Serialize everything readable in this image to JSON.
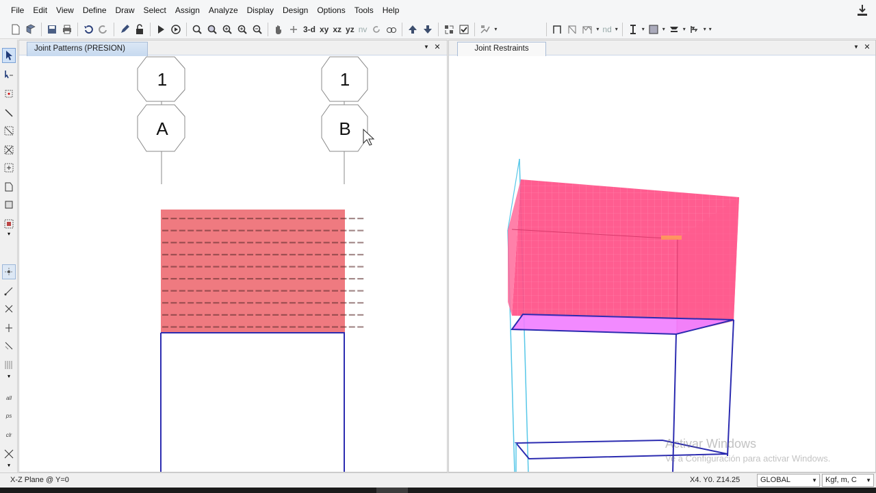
{
  "menu": [
    "File",
    "Edit",
    "View",
    "Define",
    "Draw",
    "Select",
    "Assign",
    "Analyze",
    "Display",
    "Design",
    "Options",
    "Tools",
    "Help"
  ],
  "toolbar": {
    "view_3d": "3-d",
    "view_xy": "xy",
    "view_xz": "xz",
    "view_yz": "yz",
    "view_nv": "nv",
    "nd_label": "nd"
  },
  "left_panel": {
    "tab_title": "Joint Patterns (PRESION)",
    "grid_bubbles": [
      {
        "row_label": "1",
        "col_label": "A"
      },
      {
        "row_label": "1",
        "col_label": "B"
      }
    ]
  },
  "right_panel": {
    "tab_title": "Joint Restraints"
  },
  "watermark": {
    "title": "Activar Windows",
    "subtitle": "Ve a Configuración para activar Windows."
  },
  "statusbar": {
    "plane": "X-Z Plane @ Y=0",
    "coords": "X4.  Y0.  Z14.25",
    "coord_system": "GLOBAL",
    "units": "Kgf, m, C"
  },
  "colors": {
    "load_fill": "#ef7a80",
    "load_3d": "#ff4f87",
    "slab": "#f17dff",
    "frame": "#2b2bb0",
    "frame_light": "#56c7e8"
  }
}
